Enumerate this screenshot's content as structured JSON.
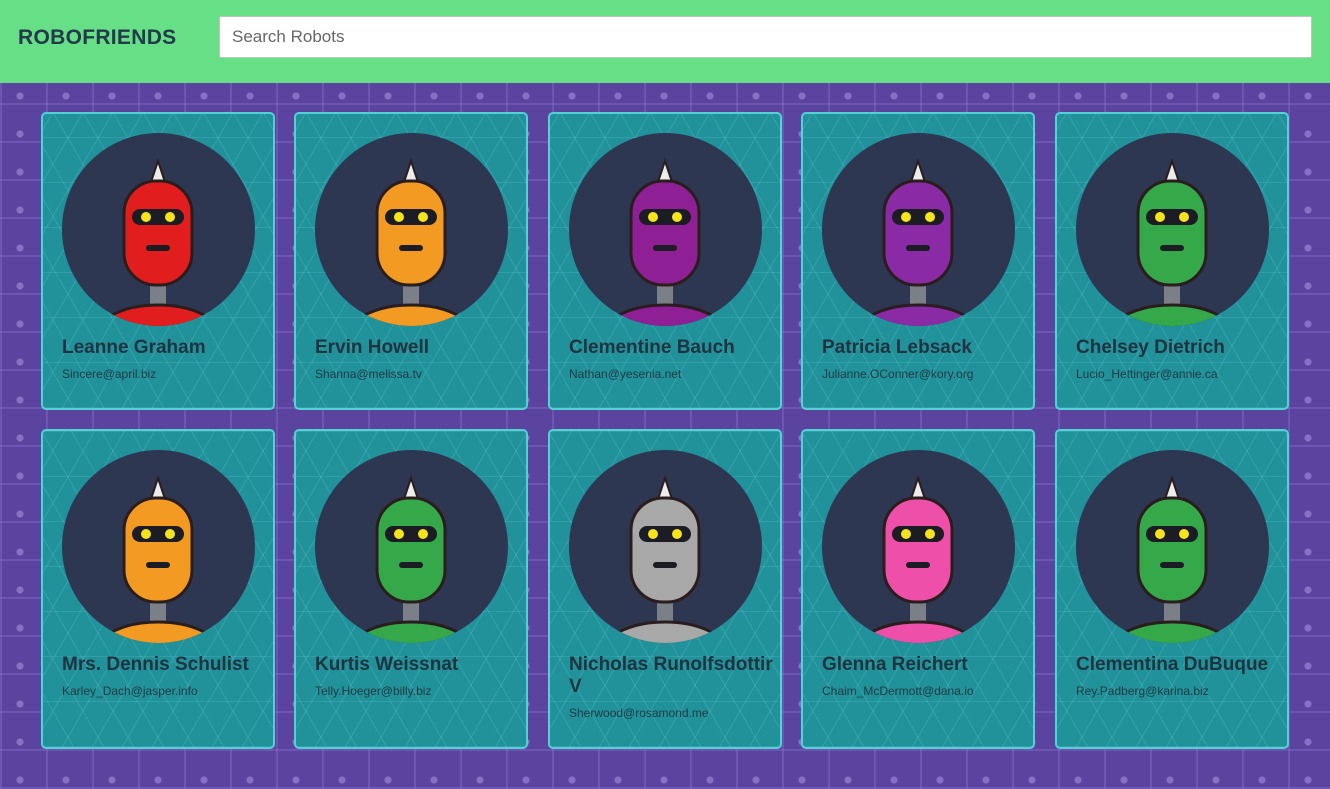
{
  "app": {
    "title": "ROBOFRIENDS"
  },
  "search": {
    "placeholder": "Search Robots",
    "value": ""
  },
  "robots": [
    {
      "name": "Leanne Graham",
      "email": "Sincere@april.biz",
      "color": "#e21d1d"
    },
    {
      "name": "Ervin Howell",
      "email": "Shanna@melissa.tv",
      "color": "#f29a22"
    },
    {
      "name": "Clementine Bauch",
      "email": "Nathan@yesenia.net",
      "color": "#8e1f95"
    },
    {
      "name": "Patricia Lebsack",
      "email": "Julianne.OConner@kory.org",
      "color": "#8a2aa4"
    },
    {
      "name": "Chelsey Dietrich",
      "email": "Lucio_Hettinger@annie.ca",
      "color": "#35a84a"
    },
    {
      "name": "Mrs. Dennis Schulist",
      "email": "Karley_Dach@jasper.info",
      "color": "#f29a22"
    },
    {
      "name": "Kurtis Weissnat",
      "email": "Telly.Hoeger@billy.biz",
      "color": "#35a84a"
    },
    {
      "name": "Nicholas Runolfsdottir V",
      "email": "Sherwood@rosamond.me",
      "color": "#a8a8a8"
    },
    {
      "name": "Glenna Reichert",
      "email": "Chaim_McDermott@dana.io",
      "color": "#ee4fa8"
    },
    {
      "name": "Clementina DuBuque",
      "email": "Rey.Padberg@karina.biz",
      "color": "#35a84a"
    }
  ]
}
